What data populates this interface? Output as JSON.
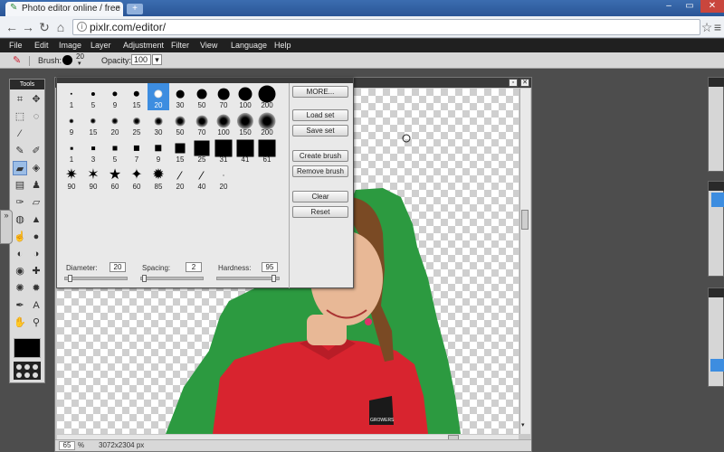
{
  "browser": {
    "tab_title": "Photo editor online / free in",
    "tab_close": "×",
    "new_tab": "+",
    "url": "pixlr.com/editor/",
    "back": "←",
    "forward": "→",
    "reload": "↻",
    "home": "⌂",
    "star": "☆",
    "settings": "≡"
  },
  "menubar": [
    "File",
    "Edit",
    "Image",
    "Layer",
    "Adjustment",
    "Filter",
    "View",
    "Language",
    "Help"
  ],
  "options": {
    "brush_label": "Brush:",
    "brush_size": "20",
    "opacity_label": "Opacity:",
    "opacity_value": "100",
    "dropdown_arrow": "▾"
  },
  "tools_panel": {
    "title": "Tools",
    "tool_icons": [
      "crop-icon",
      "move-icon",
      "marquee-icon",
      "lasso-icon",
      "wand-icon",
      "blank",
      "pencil-icon",
      "brush-icon",
      "eraser-icon",
      "bucket-icon",
      "gradient-icon",
      "stamp-icon",
      "color-replace-icon",
      "drawing-icon",
      "blur-icon",
      "sharpen-icon",
      "smudge-icon",
      "sponge-icon",
      "dodge-icon",
      "burn-icon",
      "redeye-icon",
      "spot-heal-icon",
      "bloat-icon",
      "pinch-icon",
      "colorpicker-icon",
      "type-icon",
      "hand-icon",
      "zoom-icon"
    ],
    "side_handle": "»"
  },
  "brush_dialog": {
    "rows": [
      [
        "1",
        "5",
        "9",
        "15",
        "20",
        "30",
        "50",
        "70",
        "100",
        "200"
      ],
      [
        "9",
        "15",
        "20",
        "25",
        "30",
        "50",
        "70",
        "100",
        "150",
        "200"
      ],
      [
        "1",
        "3",
        "5",
        "7",
        "9",
        "15",
        "25",
        "31",
        "41",
        "61"
      ],
      [
        "90",
        "90",
        "60",
        "60",
        "85",
        "20",
        "40",
        "20"
      ]
    ],
    "selected": "20",
    "buttons": [
      "MORE...",
      "Load set",
      "Save set",
      "Create brush",
      "Remove brush",
      "Clear",
      "Reset"
    ],
    "diameter_label": "Diameter:",
    "diameter_value": "20",
    "spacing_label": "Spacing:",
    "spacing_value": "2",
    "hardness_label": "Hardness:",
    "hardness_value": "95",
    "hardness_level_pct": 95,
    "spacing_level_pct": 2,
    "diameter_level_pct": 5
  },
  "document": {
    "zoom": "65",
    "zoom_unit": "%",
    "dimensions": "3072x2304 px",
    "shirt_badge": "GROWERS"
  },
  "colors": {
    "green_screen": "#2c9a40",
    "shirt": "#d8242f",
    "skin": "#e8b896",
    "hair": "#7a4a24",
    "selection_blue": "#3d8de0"
  }
}
